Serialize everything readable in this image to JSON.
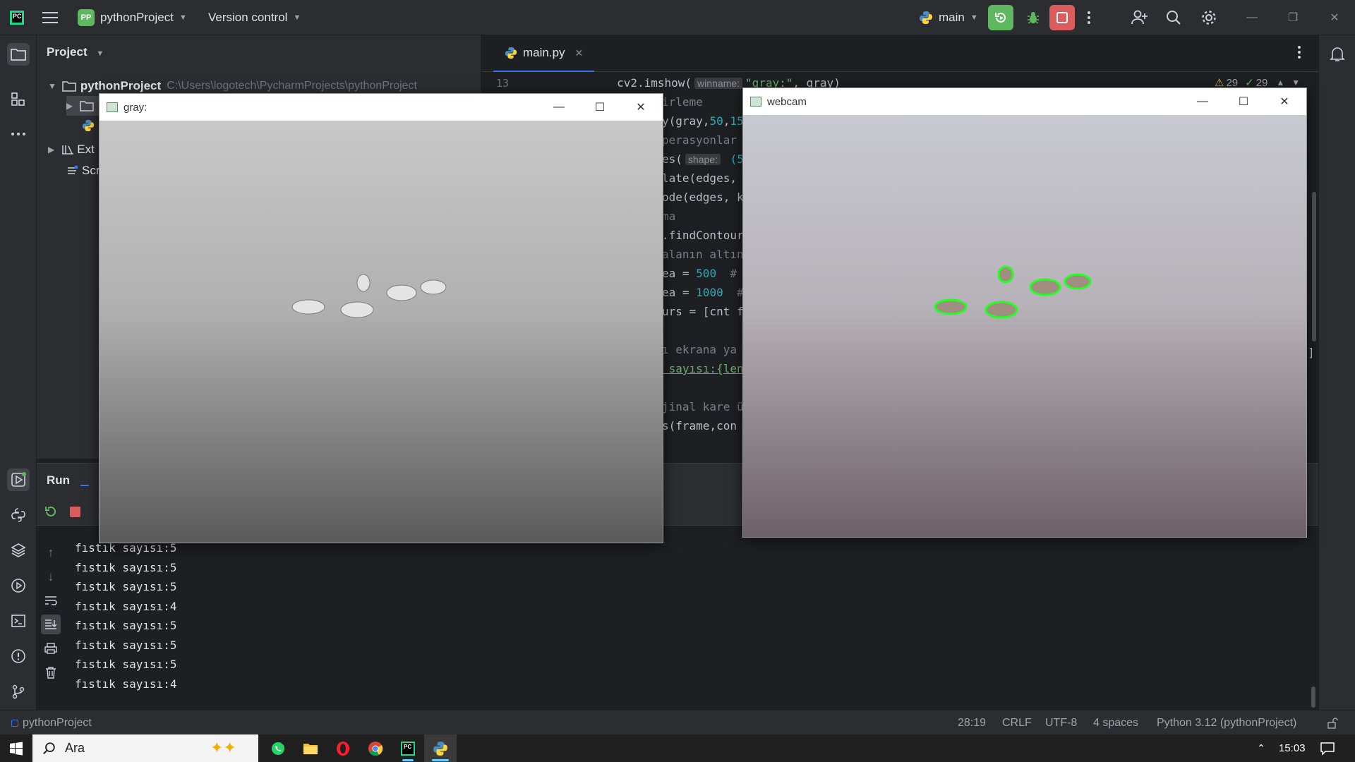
{
  "titlebar": {
    "project_badge": "PP",
    "project_name": "pythonProject",
    "version_control": "Version control",
    "branch": "main"
  },
  "project_panel": {
    "title": "Project",
    "root_name": "pythonProject",
    "root_path": "C:\\Users\\logotech\\PycharmProjects\\pythonProject",
    "ext_item": "Ext",
    "scr_item": "Scr"
  },
  "editor": {
    "tab_label": "main.py",
    "warnings": "29",
    "checks": "29",
    "lines": [
      {
        "num": "13",
        "pre": "cv2.imshow(",
        "hint": "winname:",
        "post_str": "\"gray:\"",
        "post": ", gray)"
      },
      {
        "num": "",
        "text": "irleme",
        "cls": "com"
      },
      {
        "num": "",
        "text": "y(gray,",
        "num1": "50",
        "sep": ",",
        "num2": "15"
      },
      {
        "num": "",
        "text": "perasyonlar",
        "cls": "com"
      },
      {
        "num": "",
        "text": "es(",
        "hint": "shape:",
        "tail": " (5"
      },
      {
        "num": "",
        "text": "late(edges,"
      },
      {
        "num": "",
        "text": "ode(edges, k"
      },
      {
        "num": "",
        "text": "ma",
        "cls": "com"
      },
      {
        "num": "",
        "text": ".findContour"
      },
      {
        "num": "",
        "text": "alanın altın",
        "cls": "com"
      },
      {
        "num": "",
        "text": "ea = ",
        "val": "500",
        "tail": "  #"
      },
      {
        "num": "",
        "text": "ea = ",
        "val": "1000",
        "tail": "  #"
      },
      {
        "num": "",
        "text": "urs = [cnt f"
      },
      {
        "num": "",
        "text": ""
      },
      {
        "num": "",
        "text": "ı ekrana ya",
        "cls": "com"
      },
      {
        "num": "",
        "text": " sayısı:{len"
      },
      {
        "num": "",
        "text": ""
      },
      {
        "num": "",
        "text": "jinal kare ü",
        "cls": "com"
      },
      {
        "num": "",
        "text": "s(frame,con"
      }
    ],
    "bracket_right": "]"
  },
  "cv_gray": {
    "title": "gray:"
  },
  "cv_webcam": {
    "title": "webcam"
  },
  "run_panel": {
    "tab_label": "Run",
    "console": [
      "fıstık sayısı:5",
      "fıstık sayısı:5",
      "fıstık sayısı:5",
      "fıstık sayısı:4",
      "fıstık sayısı:5",
      "fıstık sayısı:5",
      "fıstık sayısı:5",
      "fıstık sayısı:4"
    ]
  },
  "statusbar": {
    "breadcrumb": "pythonProject",
    "position": "28:19",
    "line_sep": "CRLF",
    "encoding": "UTF-8",
    "indent": "4 spaces",
    "interpreter": "Python 3.12 (pythonProject)"
  },
  "taskbar": {
    "search_placeholder": "Ara",
    "time": "15:03"
  },
  "colors": {
    "accent": "#3574f0",
    "run_green": "#5fb860",
    "stop_red": "#db5c5c",
    "contour_green": "#22ff22"
  }
}
